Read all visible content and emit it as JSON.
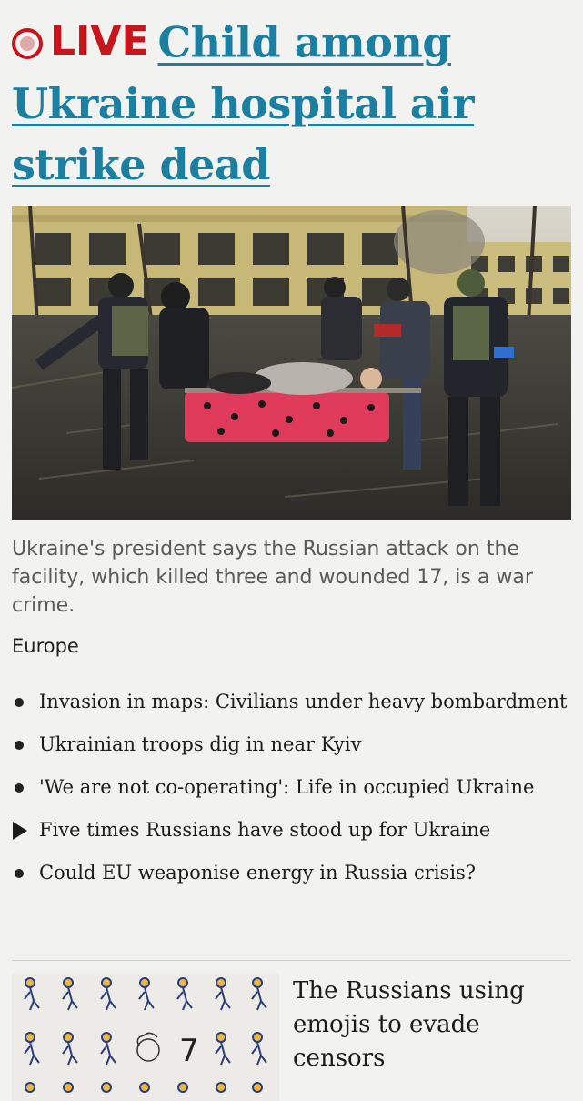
{
  "headline": {
    "live_label": "LIVE",
    "title": "Child among Ukraine hospital air strike dead"
  },
  "photo": {
    "icon": "news-photo"
  },
  "summary": "Ukraine's president says the Russian attack on the facility, which killed three and wounded 17, is a war crime.",
  "section": "Europe",
  "related": [
    {
      "type": "bullet",
      "text": "Invasion in maps: Civilians under heavy bombardment"
    },
    {
      "type": "bullet",
      "text": "Ukrainian troops dig in near Kyiv"
    },
    {
      "type": "bullet",
      "text": "'We are not co-operating': Life in occupied Ukraine"
    },
    {
      "type": "video",
      "text": "Five times Russians have stood up for Ukraine"
    },
    {
      "type": "bullet",
      "text": "Could EU weaponise energy in Russia crisis?"
    }
  ],
  "card": {
    "title": "The Russians using emojis to evade censors",
    "thumb_number": "7"
  },
  "colors": {
    "live_red": "#c8141b",
    "link_blue": "#1a7fa0",
    "background": "#f2f2f0"
  }
}
